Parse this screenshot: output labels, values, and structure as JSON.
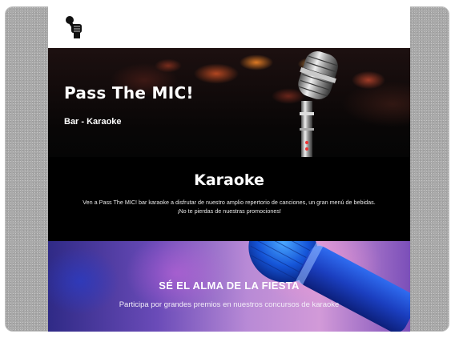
{
  "site": {
    "logo_icon": "microphone-fist-icon"
  },
  "hero": {
    "title": "Pass The MIC!",
    "subtitle": "Bar - Karaoke",
    "image_icon": "vintage-microphone-icon"
  },
  "karaoke": {
    "title": "Karaoke",
    "description_line1": "Ven a Pass The MIC! bar karaoke a disfrutar de nuestro amplio repertorio de canciones, un gran menú de bebidas.",
    "description_line2": "¡No te pierdas de nuestras promociones!"
  },
  "promo": {
    "title": "SÉ EL ALMA DE LA FIESTA",
    "subtitle": "Participa por grandes premios en nuestros concursos de karaoke",
    "image_icon": "blue-microphone-icon"
  },
  "colors": {
    "frame_bg": "#a9a9a9",
    "section_dark": "#000000",
    "text_light": "#ffffff",
    "promo_accent": "#b88ad6"
  }
}
